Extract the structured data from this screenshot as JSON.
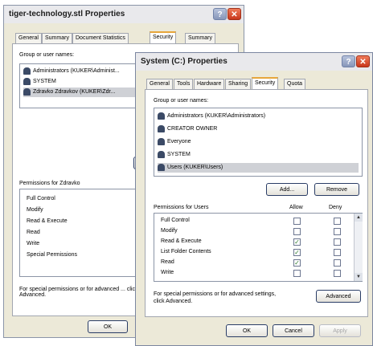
{
  "back_window": {
    "title": "tiger-technology.stl Properties",
    "help_glyph": "?",
    "close_glyph": "✕",
    "tabs": [
      "General",
      "Summary",
      "Document Statistics",
      "Security",
      "Summary"
    ],
    "active_tab_index": 3,
    "group_label": "Group or user names:",
    "users": [
      {
        "name": "Administrators (KUKER\\Administ...",
        "icon": "group-icon"
      },
      {
        "name": "SYSTEM",
        "icon": "group-icon"
      },
      {
        "name": "Zdravko Zdravkov (KUKER\\Zdr...",
        "icon": "user-icon",
        "selected": true
      }
    ],
    "permissions_label": "Permissions for Zdravko",
    "permissions": [
      "Full Control",
      "Modify",
      "Read & Execute",
      "Read",
      "Write",
      "Special Permissions"
    ],
    "advanced_note": "For special permissions or for advanced ... click Advanced.",
    "ok_label": "OK"
  },
  "front_window": {
    "title": "System (C:) Properties",
    "help_glyph": "?",
    "close_glyph": "✕",
    "tabs": [
      "General",
      "Tools",
      "Hardware",
      "Sharing",
      "Security",
      "Quota"
    ],
    "active_tab_index": 4,
    "group_label": "Group or user names:",
    "users": [
      {
        "name": "Administrators (KUKER\\Administrators)",
        "icon": "group-icon"
      },
      {
        "name": "CREATOR OWNER",
        "icon": "group-icon"
      },
      {
        "name": "Everyone",
        "icon": "group-icon"
      },
      {
        "name": "SYSTEM",
        "icon": "group-icon"
      },
      {
        "name": "Users (KUKER\\Users)",
        "icon": "group-icon",
        "selected": true
      }
    ],
    "add_label": "Add...",
    "remove_label": "Remove",
    "permissions_label": "Permissions for Users",
    "allow_label": "Allow",
    "deny_label": "Deny",
    "permissions": [
      {
        "name": "Full Control",
        "allow": false,
        "deny": false
      },
      {
        "name": "Modify",
        "allow": false,
        "deny": false
      },
      {
        "name": "Read & Execute",
        "allow": true,
        "deny": false
      },
      {
        "name": "List Folder Contents",
        "allow": true,
        "deny": false
      },
      {
        "name": "Read",
        "allow": true,
        "deny": false
      },
      {
        "name": "Write",
        "allow": false,
        "deny": false
      }
    ],
    "advanced_note_line1": "For special permissions or for advanced settings,",
    "advanced_note_line2": "click Advanced.",
    "advanced_label": "Advanced",
    "ok_label": "OK",
    "cancel_label": "Cancel",
    "apply_label": "Apply",
    "check_glyph": "✓",
    "scroll_up_glyph": "▲",
    "scroll_down_glyph": "▼"
  }
}
